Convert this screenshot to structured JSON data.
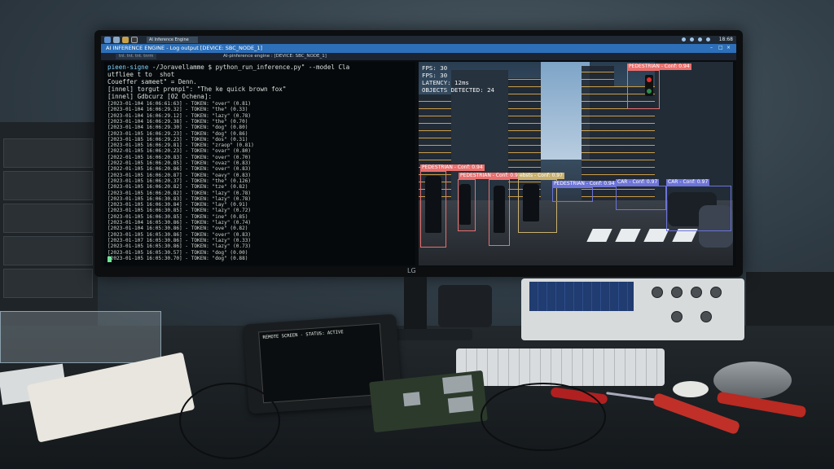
{
  "taskbar": {
    "task_label": "AI Inference Engine",
    "clock": "18:68"
  },
  "window": {
    "title": "AI INFERENCE ENGINE - Log output [DEVICE: SBC_NODE_1]",
    "subtitle": "AI-pinference engine : [DEVICE: SBC_NODE_1]",
    "tab_label": "tnl. tnt. tnt. tnrrn"
  },
  "terminal": {
    "header_lines": [
      {
        "user": "pieen-signe",
        "rest": "-/Joravellamme $ python_run_inference.py\" --model Cla"
      },
      {
        "user": "",
        "rest": "utfliee t to  shot"
      },
      {
        "user": "",
        "rest": "Coueffer sameet\" = Denn."
      },
      {
        "user": "",
        "rest": "[innel] torgut prenpi\": \"The ke quick brown fox\""
      },
      {
        "user": "",
        "rest": "[innel] Gdbcurz [02 Ochena]:"
      }
    ],
    "log_lines": [
      "[2023-01-104 16:06:61:63] - TOKEN: \"over\" (0.81)",
      "[2023-01-104 16:06:29.32] - TOKEN: \"the\" (0.33)",
      "[2023-01-104 16:06:29.12] - TOKEN: \"lazy\" (0.78)",
      "[2023-01-104 16:06:29.38] - TOKEN: \"the\" (0.70)",
      "[2023-01-104 16:06:29.30] - TOKEN: \"dog\" (0.80)",
      "[2023-01-105 16:06:29.23] - TOKEN: \"dog\" (0.86)",
      "[2023-01-185 16:06:29.23] - TOKEN: \"dos\" (0.31)",
      "[2023-01-105 16:06:29.81] - TOKEN: \"zraop\" (0.81)",
      "[2022-01-105 16:06:20.23] - TOKEN: \"ovar\" (0.80)",
      "[2022-01-105 16:06:20.83] - TOKEN: \"over\" (0.70)",
      "[2022-01-105 16:06:20.85] - TOKEN: \"ovaz\" (0.83)",
      "[2022-01-105 16:06:20.86] - TOKEN: \"over\" (0.83)",
      "[2023-01-105 16:06:20.87] - TOKEN: \"oavy\" (0.83)",
      "[2023-01-105 16:06:20.37] - TOKEN: \"the\" (0.126)",
      "[2023-01-105 16:06:20.82] - TOKEN: \"tze\" (0.82)",
      "[2023-01-105 16:06:20.82] - TOKEN: \"lazy\" (0.78)",
      "[2023-01-105 16:06:30.83] - TOKEN: \"lazy\" (0.78)",
      "[2023-01-105 16:06:30.84] - TOKEN: \"lay\" (0.91)",
      "[2023-01-105 16:06:30.85] - TOKEN: \"lazy\" (0.72)",
      "[2023-01-105 16:06:30.85] - TOKEN: \"ine\" (0.85)",
      "[2023-01-104 16:05:30.86] - TOKEN: \"lazy\" (0.74)",
      "[2023-01-104 16:05:30.86] - TOKEN: \"ove\" (0.82)",
      "[2023-01-105 16:05:30.86] - TOKEN: \"over\" (0.83)",
      "[2023-01-107 16:05:30.86] - TOKEN: \"lazy\" (0.33)",
      "[2023-01-105 16:05:30.86] - TOKEN: \"lazy\" (0.73)",
      "[2023-01-105 16:05:30.57] - TOKEN: \"dog\" (0.00)",
      "[2023-01-105 16:05:30.70] - TOKEN: \"dog\" (0.88)"
    ]
  },
  "feed": {
    "stats": [
      "FPS: 30",
      "FPS: 30",
      "LATENCY: 12ms",
      "OBJECTS DETECTED: 24"
    ],
    "detections": [
      {
        "label": "PEDESTRIAN - Conf: 0.94",
        "color": "#e8706e"
      },
      {
        "label": "PEDESTRIAN - Conf: 0.94",
        "color": "#e8706e"
      },
      {
        "label": "PEDESTRIAN - Conf: 0.94",
        "color": "#e8706e"
      },
      {
        "label": "ebsts - Conf: 0.97",
        "color": "#c9b070"
      },
      {
        "label": "PEDESTRIAN - Conf: 0.94",
        "color": "#6d74d8"
      },
      {
        "label": "CAR - Conf: 0.97",
        "color": "#6d74d8"
      },
      {
        "label": "CAR - Conf: 0.97",
        "color": "#6d74d8"
      }
    ]
  },
  "devices": {
    "monitor_brand": "LG",
    "handheld_status": "REMOTE SCREEN - STATUS: ACTIVE"
  },
  "colors": {
    "accent": "#2d6fb8",
    "terminal_bg": "#06090b",
    "detection_red": "#e8706e",
    "detection_blue": "#6d74d8"
  }
}
